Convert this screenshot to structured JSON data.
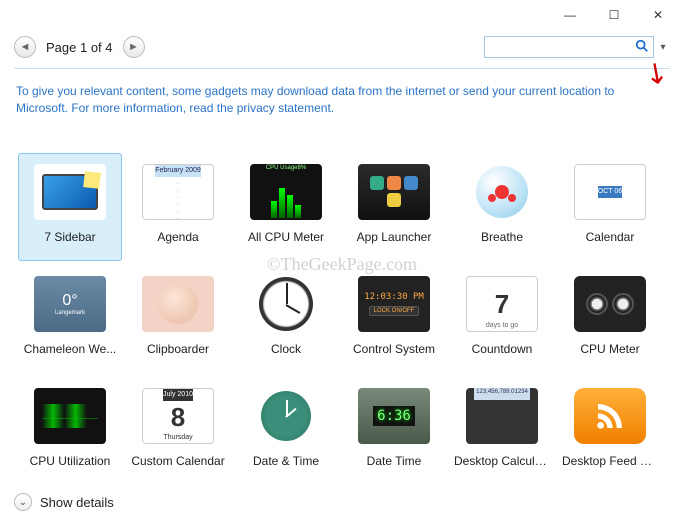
{
  "titlebar": {
    "minimize": "—",
    "maximize": "☐",
    "close": "✕"
  },
  "toolbar": {
    "page_label": "Page 1 of 4",
    "search_placeholder": ""
  },
  "info_text": "To give you relevant content, some gadgets may download data from the internet or send your current location to Microsoft. For more information, read the privacy statement.",
  "watermark": "©TheGeekPage.com",
  "gadgets": [
    {
      "label": "7 Sidebar",
      "selected": true,
      "thumb": "monitor"
    },
    {
      "label": "Agenda",
      "selected": false,
      "thumb": "agenda",
      "header": "February 2009"
    },
    {
      "label": "All CPU Meter",
      "selected": false,
      "thumb": "cpu",
      "top_left": "CPU Usage",
      "top_right": "8%"
    },
    {
      "label": "App Launcher",
      "selected": false,
      "thumb": "launch"
    },
    {
      "label": "Breathe",
      "selected": false,
      "thumb": "breathe"
    },
    {
      "label": "Calendar",
      "selected": false,
      "thumb": "calendar",
      "month": "OCT 06"
    },
    {
      "label": "Chameleon We...",
      "selected": false,
      "thumb": "chameleon",
      "temp": "0°",
      "loc": "Langemark"
    },
    {
      "label": "Clipboarder",
      "selected": false,
      "thumb": "baby"
    },
    {
      "label": "Clock",
      "selected": false,
      "thumb": "clock"
    },
    {
      "label": "Control System",
      "selected": false,
      "thumb": "control",
      "time": "12:03:30 PM",
      "lock": "LOCK ON/OFF"
    },
    {
      "label": "Countdown",
      "selected": false,
      "thumb": "countdown",
      "big": "7",
      "sub": "days to go"
    },
    {
      "label": "CPU Meter",
      "selected": false,
      "thumb": "meter"
    },
    {
      "label": "CPU Utilization",
      "selected": false,
      "thumb": "util"
    },
    {
      "label": "Custom Calendar",
      "selected": false,
      "thumb": "custom",
      "top": "July 2010",
      "num": "8",
      "day": "Thursday"
    },
    {
      "label": "Date & Time",
      "selected": false,
      "thumb": "dt"
    },
    {
      "label": "Date Time",
      "selected": false,
      "thumb": "datetime",
      "digits": "6:36"
    },
    {
      "label": "Desktop Calcula...",
      "selected": false,
      "thumb": "calc",
      "disp": "123,456,789.01234"
    },
    {
      "label": "Desktop Feed R...",
      "selected": false,
      "thumb": "rss"
    }
  ],
  "footer": {
    "show_details": "Show details"
  }
}
